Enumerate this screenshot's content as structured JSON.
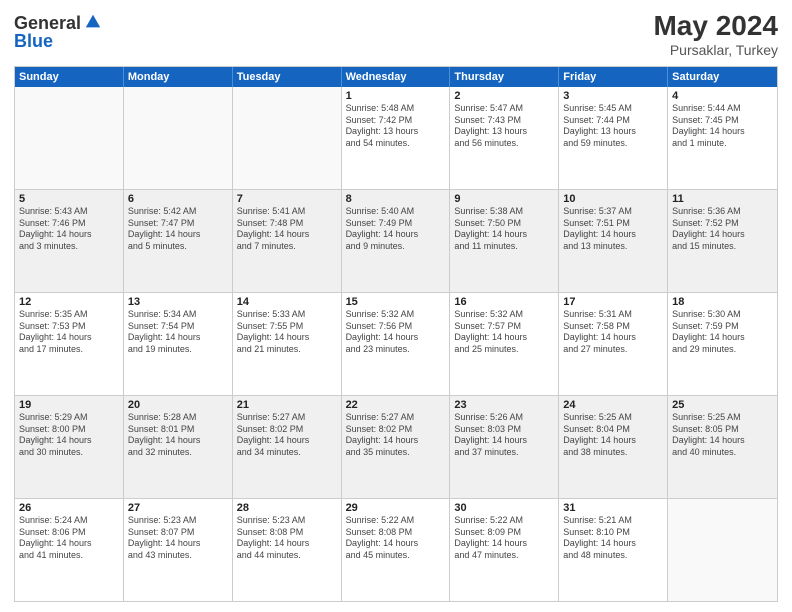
{
  "logo": {
    "general": "General",
    "blue": "Blue"
  },
  "header": {
    "month_year": "May 2024",
    "location": "Pursaklar, Turkey"
  },
  "weekdays": [
    "Sunday",
    "Monday",
    "Tuesday",
    "Wednesday",
    "Thursday",
    "Friday",
    "Saturday"
  ],
  "rows": [
    [
      {
        "day": "",
        "info": ""
      },
      {
        "day": "",
        "info": ""
      },
      {
        "day": "",
        "info": ""
      },
      {
        "day": "1",
        "info": "Sunrise: 5:48 AM\nSunset: 7:42 PM\nDaylight: 13 hours\nand 54 minutes."
      },
      {
        "day": "2",
        "info": "Sunrise: 5:47 AM\nSunset: 7:43 PM\nDaylight: 13 hours\nand 56 minutes."
      },
      {
        "day": "3",
        "info": "Sunrise: 5:45 AM\nSunset: 7:44 PM\nDaylight: 13 hours\nand 59 minutes."
      },
      {
        "day": "4",
        "info": "Sunrise: 5:44 AM\nSunset: 7:45 PM\nDaylight: 14 hours\nand 1 minute."
      }
    ],
    [
      {
        "day": "5",
        "info": "Sunrise: 5:43 AM\nSunset: 7:46 PM\nDaylight: 14 hours\nand 3 minutes."
      },
      {
        "day": "6",
        "info": "Sunrise: 5:42 AM\nSunset: 7:47 PM\nDaylight: 14 hours\nand 5 minutes."
      },
      {
        "day": "7",
        "info": "Sunrise: 5:41 AM\nSunset: 7:48 PM\nDaylight: 14 hours\nand 7 minutes."
      },
      {
        "day": "8",
        "info": "Sunrise: 5:40 AM\nSunset: 7:49 PM\nDaylight: 14 hours\nand 9 minutes."
      },
      {
        "day": "9",
        "info": "Sunrise: 5:38 AM\nSunset: 7:50 PM\nDaylight: 14 hours\nand 11 minutes."
      },
      {
        "day": "10",
        "info": "Sunrise: 5:37 AM\nSunset: 7:51 PM\nDaylight: 14 hours\nand 13 minutes."
      },
      {
        "day": "11",
        "info": "Sunrise: 5:36 AM\nSunset: 7:52 PM\nDaylight: 14 hours\nand 15 minutes."
      }
    ],
    [
      {
        "day": "12",
        "info": "Sunrise: 5:35 AM\nSunset: 7:53 PM\nDaylight: 14 hours\nand 17 minutes."
      },
      {
        "day": "13",
        "info": "Sunrise: 5:34 AM\nSunset: 7:54 PM\nDaylight: 14 hours\nand 19 minutes."
      },
      {
        "day": "14",
        "info": "Sunrise: 5:33 AM\nSunset: 7:55 PM\nDaylight: 14 hours\nand 21 minutes."
      },
      {
        "day": "15",
        "info": "Sunrise: 5:32 AM\nSunset: 7:56 PM\nDaylight: 14 hours\nand 23 minutes."
      },
      {
        "day": "16",
        "info": "Sunrise: 5:32 AM\nSunset: 7:57 PM\nDaylight: 14 hours\nand 25 minutes."
      },
      {
        "day": "17",
        "info": "Sunrise: 5:31 AM\nSunset: 7:58 PM\nDaylight: 14 hours\nand 27 minutes."
      },
      {
        "day": "18",
        "info": "Sunrise: 5:30 AM\nSunset: 7:59 PM\nDaylight: 14 hours\nand 29 minutes."
      }
    ],
    [
      {
        "day": "19",
        "info": "Sunrise: 5:29 AM\nSunset: 8:00 PM\nDaylight: 14 hours\nand 30 minutes."
      },
      {
        "day": "20",
        "info": "Sunrise: 5:28 AM\nSunset: 8:01 PM\nDaylight: 14 hours\nand 32 minutes."
      },
      {
        "day": "21",
        "info": "Sunrise: 5:27 AM\nSunset: 8:02 PM\nDaylight: 14 hours\nand 34 minutes."
      },
      {
        "day": "22",
        "info": "Sunrise: 5:27 AM\nSunset: 8:02 PM\nDaylight: 14 hours\nand 35 minutes."
      },
      {
        "day": "23",
        "info": "Sunrise: 5:26 AM\nSunset: 8:03 PM\nDaylight: 14 hours\nand 37 minutes."
      },
      {
        "day": "24",
        "info": "Sunrise: 5:25 AM\nSunset: 8:04 PM\nDaylight: 14 hours\nand 38 minutes."
      },
      {
        "day": "25",
        "info": "Sunrise: 5:25 AM\nSunset: 8:05 PM\nDaylight: 14 hours\nand 40 minutes."
      }
    ],
    [
      {
        "day": "26",
        "info": "Sunrise: 5:24 AM\nSunset: 8:06 PM\nDaylight: 14 hours\nand 41 minutes."
      },
      {
        "day": "27",
        "info": "Sunrise: 5:23 AM\nSunset: 8:07 PM\nDaylight: 14 hours\nand 43 minutes."
      },
      {
        "day": "28",
        "info": "Sunrise: 5:23 AM\nSunset: 8:08 PM\nDaylight: 14 hours\nand 44 minutes."
      },
      {
        "day": "29",
        "info": "Sunrise: 5:22 AM\nSunset: 8:08 PM\nDaylight: 14 hours\nand 45 minutes."
      },
      {
        "day": "30",
        "info": "Sunrise: 5:22 AM\nSunset: 8:09 PM\nDaylight: 14 hours\nand 47 minutes."
      },
      {
        "day": "31",
        "info": "Sunrise: 5:21 AM\nSunset: 8:10 PM\nDaylight: 14 hours\nand 48 minutes."
      },
      {
        "day": "",
        "info": ""
      }
    ]
  ]
}
